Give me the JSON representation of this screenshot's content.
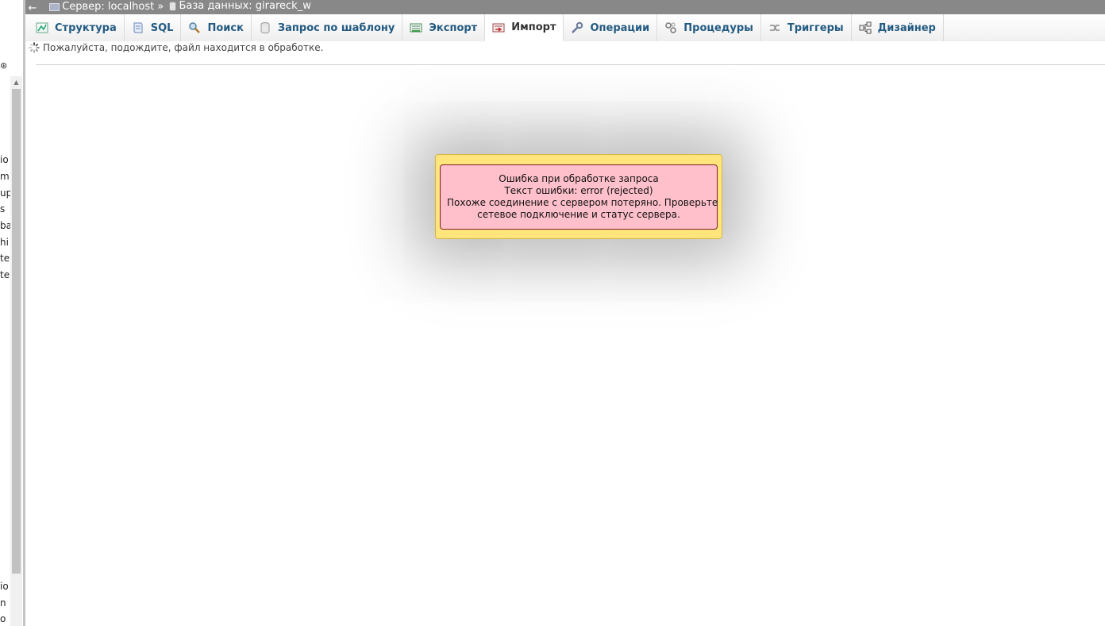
{
  "breadcrumb": {
    "back": "←",
    "server_label": "Сервер: localhost »",
    "db_label": "База данных: girareck_w"
  },
  "tabs": [
    {
      "label": "Структура",
      "icon": "structure-icon"
    },
    {
      "label": "SQL",
      "icon": "sql-icon"
    },
    {
      "label": "Поиск",
      "icon": "search-icon"
    },
    {
      "label": "Запрос по шаблону",
      "icon": "query-icon"
    },
    {
      "label": "Экспорт",
      "icon": "export-icon"
    },
    {
      "label": "Импорт",
      "icon": "import-icon"
    },
    {
      "label": "Операции",
      "icon": "wrench-icon"
    },
    {
      "label": "Процедуры",
      "icon": "routines-icon"
    },
    {
      "label": "Триггеры",
      "icon": "triggers-icon"
    },
    {
      "label": "Дизайнер",
      "icon": "designer-icon"
    }
  ],
  "active_tab": "Импорт",
  "status": {
    "text": "Пожалуйста, подождите, файл находится в обработке."
  },
  "error": {
    "line1": "Ошибка при обработке запроса",
    "line2": "Текст ошибки: error (rejected)",
    "line3": "Похоже соединение с сервером потеряно. Проверьте",
    "line4": "сетевое подключение и статус сервера."
  },
  "left_nav": {
    "toggle": "⊛",
    "fragments": [
      "io",
      "m",
      "up",
      "s",
      "ba",
      "hi",
      "te",
      "te",
      "io",
      "n",
      "o"
    ]
  },
  "colors": {
    "topbar": "#888888",
    "tab_text": "#235a81",
    "dialog_bg": "#ffe57c",
    "error_bg": "#ffc0cb"
  }
}
